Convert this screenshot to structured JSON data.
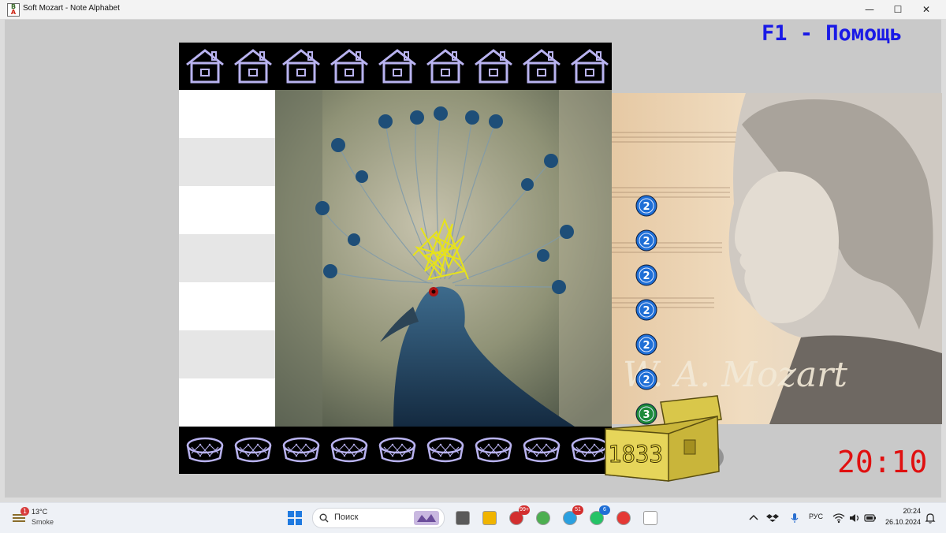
{
  "window": {
    "title": "Soft Mozart - Note Alphabet",
    "icon": "b-a-app-icon",
    "controls": {
      "minimize": "—",
      "maximize": "☐",
      "close": "✕"
    }
  },
  "game": {
    "help_label": "F1 - Помощь",
    "score": "1833",
    "timer": "20:10",
    "houses": [
      "house-icon",
      "house-icon",
      "house-icon",
      "house-icon",
      "house-icon",
      "house-icon",
      "house-icon",
      "house-icon",
      "house-icon"
    ],
    "baskets": [
      "basket-icon",
      "basket-icon",
      "basket-icon",
      "basket-icon",
      "basket-icon",
      "basket-icon",
      "basket-icon",
      "basket-icon",
      "basket-icon"
    ],
    "note_rows": 7,
    "coins": [
      {
        "label": "2",
        "color": "#1f6fd6"
      },
      {
        "label": "2",
        "color": "#1f6fd6"
      },
      {
        "label": "2",
        "color": "#1f6fd6"
      },
      {
        "label": "2",
        "color": "#1f6fd6"
      },
      {
        "label": "2",
        "color": "#1f6fd6"
      },
      {
        "label": "2",
        "color": "#1f6fd6"
      },
      {
        "label": "3",
        "color": "#1e8a3a"
      }
    ],
    "portrait_caption": "W. A. Mozart",
    "colors": {
      "help": "#1a1ae6",
      "timer": "#e01010",
      "score": "#f2e14a"
    }
  },
  "taskbar": {
    "weather": {
      "temp": "13°C",
      "condition": "Smoke",
      "badge": "1"
    },
    "search": {
      "placeholder": "Поиск"
    },
    "apps": [
      {
        "name": "explorer-files",
        "badge": ""
      },
      {
        "name": "file-explorer",
        "badge": ""
      },
      {
        "name": "opera-browser",
        "badge": "99+"
      },
      {
        "name": "chrome-browser",
        "badge": ""
      },
      {
        "name": "telegram",
        "badge": "51"
      },
      {
        "name": "whatsapp",
        "badge": "6"
      },
      {
        "name": "yandex-browser",
        "badge": ""
      },
      {
        "name": "soft-mozart",
        "badge": ""
      }
    ],
    "tray": {
      "language": "РУС"
    },
    "clock": {
      "time": "20:24",
      "date": "26.10.2024"
    }
  }
}
